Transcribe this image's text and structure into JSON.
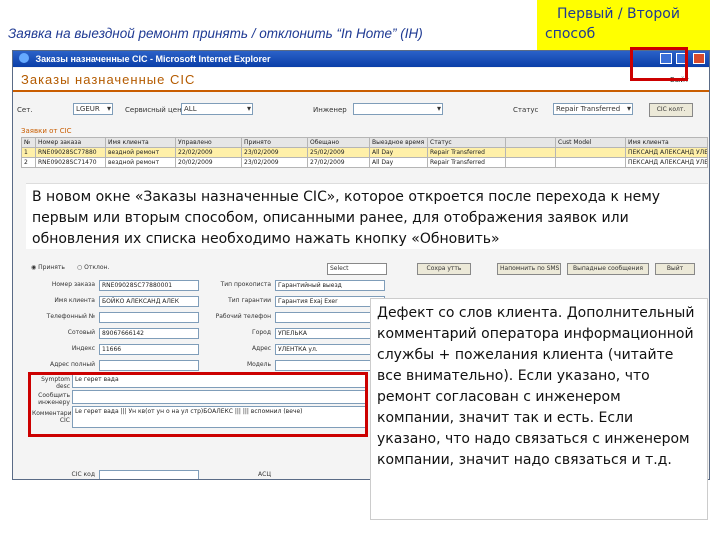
{
  "slide": {
    "title": "Заявка на выездной ремонт принять / отклонить “In Home” (IH)",
    "yellow_note_line1": "Первый / Второй",
    "yellow_note_line2": "способ"
  },
  "window": {
    "title": "Заказы назначенные CIC - Microsoft Internet Explorer"
  },
  "page": {
    "title": "Заказы назначенные CIC",
    "exit_label": "Выйт"
  },
  "filters": {
    "field1_label": "Сет.",
    "field1_value": "LGEUR",
    "field2_label": "Сервисный центр",
    "field2_value": "ALL",
    "field3_label": "Инженер",
    "status_label": "Статус",
    "status_value": "Repair Transferred",
    "refresh_button": "CIC колт."
  },
  "list": {
    "heading": "Заявки от CIC",
    "columns": [
      "№",
      "Номер заказа",
      "Имя клиента",
      "Управлено",
      "Принято",
      "Обещано",
      "Выездное время",
      "Статус",
      "",
      "Cust Model",
      "Имя клиента"
    ],
    "rows": [
      [
        "1",
        "RNE09028SC77880",
        "вездной ремонт",
        "22/02/2009",
        "23/02/2009",
        "25/02/2009",
        "All Day",
        "Repair Transferred",
        "",
        "",
        "ПЕКСАНД АЛЕКСАНД УЛЕНЕ"
      ],
      [
        "2",
        "RNE09028SC71470",
        "вездной ремонт",
        "20/02/2009",
        "23/02/2009",
        "27/02/2009",
        "All Day",
        "Repair Transferred",
        "",
        "",
        "ПЕКСАНД АЛЕКСАНД УЛЕНЕ"
      ]
    ]
  },
  "note_blue": "В  новом окне «Заказы назначенные CIC», которое откроется после перехода к нему первым или вторым способом, описанными ранее, для отображения заявок или обновления их списка необходимо нажать кнопку «Обновить»",
  "toolbar": {
    "radio1": "Принять",
    "radio2": "Отклон.",
    "select_value": "Select",
    "save_button": "Сохра утть",
    "sms_button": "Напомнить по SMS",
    "contact_button": "Выпадные сообщения",
    "exit_button": "Выйт"
  },
  "form": {
    "rows": [
      {
        "label": "Номер заказа",
        "value": "RNE09028SC77880001",
        "label2": "Тип прокописта",
        "value2": "Гарантийный выезд"
      },
      {
        "label": "Имя клиента",
        "value": "БОЙКО АЛЕКСАНД АЛЕК",
        "label2": "Тип гарантии",
        "value2": "Гарантия Еxaj Exer"
      },
      {
        "label": "Телефонный №",
        "value": "",
        "label2": "Рабочий телефон",
        "value2": ""
      },
      {
        "label": "Сотовый",
        "value": "89067666142",
        "label2": "Город",
        "value2": "УПЕЛЬКА"
      },
      {
        "label": "Индекс",
        "value": "11666",
        "label2": "Адрес",
        "value2": "УЛЕНТКА ул."
      },
      {
        "label": "Адрес полный",
        "value": "",
        "label2": "Модель",
        "value2": ""
      }
    ],
    "cic_code_label": "CIC код",
    "cic_code_label2": "АСЦ"
  },
  "defect": {
    "symptom_label": "Symptom desc",
    "symptom_value": "Le герет вада",
    "extra_label": "Сообщить инженеру",
    "extra_value": "",
    "comment_label": "Комментарий CIC",
    "comment_value": "Le герет вада ||| Ун кв(от ун о на ул стр)БОАЛЕКС ||| ||| вспомнил (вече)"
  },
  "note_white": "Дефект со слов клиента. Дополнительный комментарий оператора информационной службы + пожелания клиента (читайте все внимательно). Если указано, что ремонт согласован с инженером компании, значит так и есть. Если указано, что надо связаться с инженером компании, значит надо связаться и т.д."
}
